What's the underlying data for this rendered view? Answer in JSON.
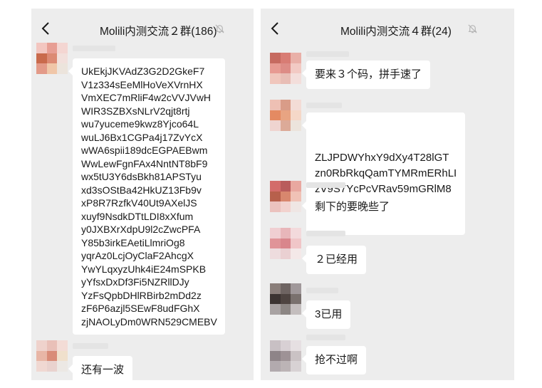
{
  "left_chat": {
    "title": "Molili内测交流２群(186)",
    "messages": [
      {
        "text": "UkEkjJKVAdZ3G2D2GkeF7\nV1z334sEeMlHoVeXVrnHX\nVmXEC7mRliF4w2cVVJVwH\nWIR3SZBXsNLrV2qjt8rtj\nwu7yuceme9kwz8Yjco64L\nwuLJ6Bx1CGPa4j17ZvYcX\nwWA6spii189dcEGPAEBwm\nWwLewFgnFAx4NntNT8bF9\nwx5tU3Y6dsBkh81APSTyu\nxd3sOStBa42HkUZ13Fb9v\nxP8R7RzfkV40Ut9AXelJS\nxuyf9NsdkDTtLDI8xXfum\ny0JXBXrXdpU9l2cZwcPFA\nY85b3irkEAetiLlmriOg8\nyqrAz0LcjOyClaF2AhcgX\nYwYLqxyzUhk4iE24mSPKB\nyYfsxDxDf3Fi5NZRllDJy\nYzFsQpbDHlRBirb2mDd2z\nzF6P6azjl5SEwF8udFGhX\nzjNAOLyDm0WRN529CMEBV"
      },
      {
        "text": "还有一波"
      }
    ]
  },
  "right_chat": {
    "title": "Molili内测交流４群(24)",
    "messages": [
      {
        "text": "要来３个码，拼手速了"
      },
      {
        "text": "ZLJPDWYhxY9dXy4T28lGT\nzn0RbRkqQamTYMRmERhLI\nzV9S7YcPcVRav59mGRlM8"
      },
      {
        "text": "剩下的要晚些了"
      },
      {
        "text": "２已经用"
      },
      {
        "text": "3已用"
      },
      {
        "text": "抢不过啊"
      }
    ]
  },
  "icons": {
    "back": "chevron-left-icon",
    "mute": "bell-off-icon"
  },
  "colors": {
    "panel_bg": "#ededed",
    "bubble_bg": "#ffffff",
    "text": "#191919"
  }
}
